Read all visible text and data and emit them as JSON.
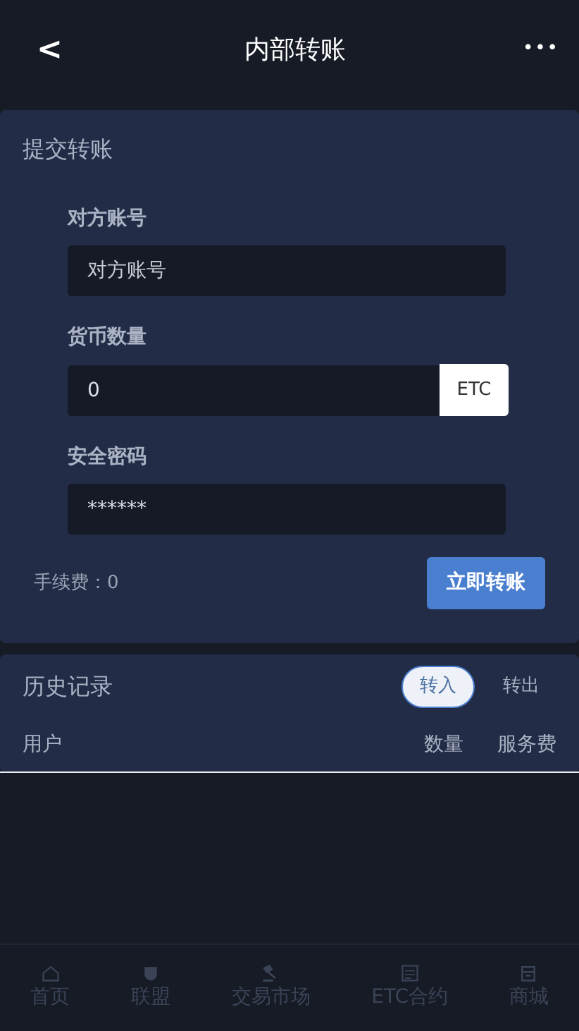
{
  "header": {
    "back": "<",
    "title": "内部转账",
    "more": "•••"
  },
  "transfer": {
    "title": "提交转账",
    "fields": [
      {
        "label": "对方账号",
        "placeholder": "对方账号"
      },
      {
        "label": "货币数量",
        "value": "0",
        "unit": "ETC"
      },
      {
        "label": "安全密码",
        "value": "******"
      }
    ],
    "fee": "手续费：0",
    "submit": "立即转账"
  },
  "history": {
    "title": "历史记录",
    "tabs": [
      {
        "label": "转入",
        "selected": true
      },
      {
        "label": "转出",
        "selected": false
      }
    ],
    "columns": [
      "用户",
      "数量",
      "服务费"
    ]
  },
  "nav": [
    {
      "label": "首页"
    },
    {
      "label": "联盟"
    },
    {
      "label": "交易市场"
    },
    {
      "label": "ETC合约"
    },
    {
      "label": "商城"
    }
  ]
}
